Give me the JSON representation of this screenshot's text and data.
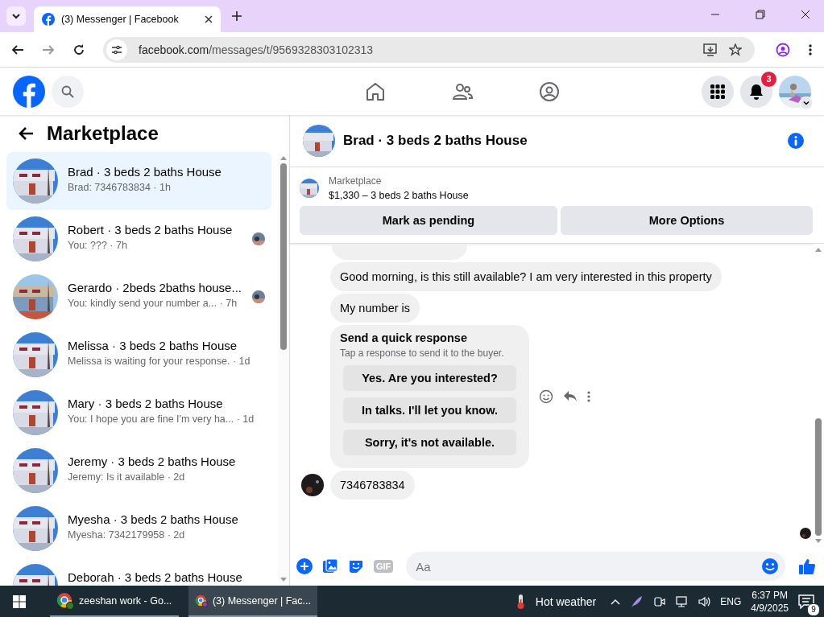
{
  "browser": {
    "tab_title": "(3) Messenger | Facebook",
    "url_domain": "facebook.com",
    "url_path": "/messages/t/9569328303102313"
  },
  "header": {
    "notifications_badge": "3"
  },
  "sidebar": {
    "title": "Marketplace",
    "conversations": [
      {
        "title": "Brad · 3 beds 2 baths House",
        "preview": "Brad: 7346783834 · 1h",
        "selected": true,
        "seen": false
      },
      {
        "title": "Robert · 3 beds 2 baths House",
        "preview": "You: ??? · 7h",
        "selected": false,
        "seen": true
      },
      {
        "title": "Gerardo · 2beds 2baths house...",
        "preview": "You: kindly send your number a...  · 7h",
        "selected": false,
        "seen": true
      },
      {
        "title": "Melissa · 3 beds 2 baths House",
        "preview": "Melissa is waiting for your response. · 1d",
        "selected": false,
        "seen": false
      },
      {
        "title": "Mary · 3 beds 2 baths House",
        "preview": "You: I hope you are fine I'm very ha... · 1d",
        "selected": false,
        "seen": false
      },
      {
        "title": "Jeremy · 3 beds 2 baths House",
        "preview": "Jeremy: Is it available · 2d",
        "selected": false,
        "seen": false
      },
      {
        "title": "Myesha · 3 beds 2 baths House",
        "preview": "Myesha: 7342179958 · 2d",
        "selected": false,
        "seen": false
      },
      {
        "title": "Deborah · 3 beds 2 baths House",
        "selected": false,
        "seen": false
      }
    ]
  },
  "chat": {
    "title": "Brad · 3 beds 2 baths House",
    "listing": {
      "label": "Marketplace",
      "title": "$1,330 – 3 beds 2 baths House",
      "buttons": [
        "Mark as pending",
        "More Options"
      ]
    },
    "messages": [
      {
        "kind": "text",
        "text": "Good morning, is this still available? I am very interested in this property",
        "avatar": false
      },
      {
        "kind": "text",
        "text": "My number is",
        "avatar": false
      },
      {
        "kind": "quick_response",
        "title": "Send a quick response",
        "hint": "Tap a response to send it to the buyer.",
        "options": [
          "Yes. Are you interested?",
          "In talks. I'll let you know.",
          "Sorry, it's not available."
        ]
      },
      {
        "kind": "text",
        "text": "7346783834",
        "avatar": true
      }
    ],
    "composer": {
      "gif_label": "GIF",
      "placeholder": "Aa"
    }
  },
  "taskbar": {
    "apps": [
      {
        "label": "zeeshan work - Go...",
        "selected": false
      },
      {
        "label": "(3) Messenger | Fac...",
        "selected": true
      }
    ],
    "weather": "Hot weather",
    "language": "ENG",
    "time": "6:37 PM",
    "date": "4/9/2025",
    "notifications": "9"
  }
}
